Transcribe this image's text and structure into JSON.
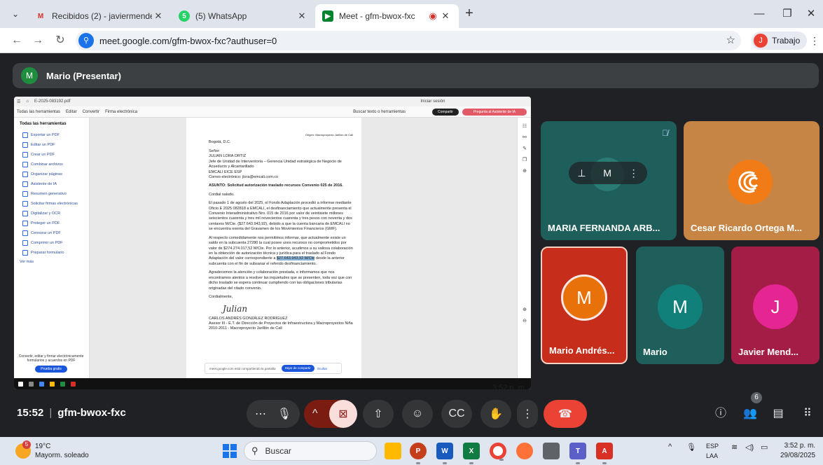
{
  "browser": {
    "tabs": [
      {
        "title": "Recibidos (2) - javiermendez@!",
        "favicon": "M",
        "color": "#d93025",
        "active": false
      },
      {
        "title": "(5) WhatsApp",
        "favicon": "5",
        "color": "#25d366",
        "active": false
      },
      {
        "title": "Meet - gfm-bwox-fxc",
        "favicon": "▶",
        "color": "#00832d",
        "active": true
      }
    ],
    "url": "meet.google.com/gfm-bwox-fxc?authuser=0",
    "profile": {
      "initial": "J",
      "name": "Trabajo"
    }
  },
  "meet": {
    "presenter": {
      "initial": "M",
      "label": "Mario (Presentar)"
    },
    "meeting_time": "15:52",
    "meeting_code": "gfm-bwox-fxc",
    "people_count": "6",
    "participants": [
      {
        "name": "MARIA FERNANDA ARB...",
        "initial": "M"
      },
      {
        "name": "Cesar Ricardo Ortega M...",
        "initial": "C"
      },
      {
        "name": "Mario Andrés...",
        "initial": "M"
      },
      {
        "name": "Mario",
        "initial": "M"
      },
      {
        "name": "Javier Mend...",
        "initial": "J"
      }
    ]
  },
  "shared_screen": {
    "tab_title": "E-2025-083192.pdf",
    "acrobat_tabs": [
      "Todas las herramientas",
      "Editar",
      "Convertir",
      "Firma electrónica"
    ],
    "search_text": "Buscar texto o herramientas",
    "share_btn": "Compartir",
    "ai_btn": "Pregunta al Asistente de IA",
    "signin": "Iniciar sesión",
    "panel_title": "Todas las herramientas",
    "panel_items": [
      "Exportar un PDF",
      "Editar un PDF",
      "Crear un PDF",
      "Combinar archivos",
      "Organizar páginas",
      "Asistente de IA",
      "Resumen generativo",
      "Solicitar firmas electrónicas",
      "Digitalizar y OCR",
      "Proteger un PDF",
      "Censurar un PDF",
      "Comprimir un PDF",
      "Preparar formulario"
    ],
    "panel_more": "Ver más",
    "panel_promo": "Convertir, editar y firmar electrónicamente formularios y acuerdos en PDF",
    "panel_try": "Prueba gratis",
    "doc": {
      "header_small": "Origen: Macroproyecto Jarillón de Cali",
      "place_date": "Bogotá, D.C.",
      "greeting_to": "Señor:",
      "recipient": "JULIAN LORA ORTIZ",
      "recipient_role": "Jefe de Unidad de Interventoría – Gerencia Unidad estratégica de Negocio de Acueducto y Alcantarillado",
      "recipient_org": "EMCALI EICE ESP",
      "recipient_email": "Correo electrónico: jlora@emcali.com.co",
      "subject": "ASUNTO: Solicitud autorización traslado recursos Convenio 025 de 2016.",
      "salutation": "Cordial saludo.",
      "p1": "El pasado 1 de agosto del 2025, el Fondo Adaptación procedió a informar mediante Oficio E 2025 082818 a EMCALI, el desfinanciamiento que actualmente presenta el Convenio Interadministrativo Nro. 015 de 2016 por valor de veintisiete millones seiscientos cuarenta y tres mil novecientos cuarenta y tres pesos con noventa y dos centavos M/Cte. ($27.643.943,92), debido a que la cuenta bancaria de EMCALI no se encuentra exenta del Gravamen de los Movimientos Financieros (GMF).",
      "p2a": "Al respecto comedidamente nos permitimos informar, que actualmente existe un saldo en la subcuenta 27280 la cual posee unos recursos no comprometidos por valor de $274.274.017,52 M/Cte. Por lo anterior, acudimos a su valiosa colaboración en la obtención de autorización técnica y jurídica para el traslado al Fondo Adaptación del valor correspondiente a",
      "p2hl": "$27.643.943,92 M/Cte",
      "p2b": "desde la anterior subcuenta con el fin de subsanar el referido desfinanciamiento.",
      "p3": "Agradecemos la atención y colaboración prestada, e informamos que nos encontramos atentos a resolver las inquietudes que se presenten, toda vez que con dicho traslado se espera continuar cumpliendo con las obligaciones tributarias originadas del citado convenio.",
      "closing": "Cordialmente,",
      "signature": "Julian",
      "sender": "CARLOS ANDRÉS GONZÁLEZ RODRÍGUEZ",
      "sender_role": "Asesor III - E.T. de Dirección de Proyectos de Infraestructura y Macroproyectos Niña 2010-2011 - Macroproyecto Jarillón de Cali"
    },
    "share_note": "meet.google.com está compartiendo la pantalla",
    "share_stop": "Dejar de compartir",
    "share_hide": "Ocultar"
  },
  "taskbar": {
    "weather_temp": "19°C",
    "weather_desc": "Mayorm. soleado",
    "weather_badge": "5",
    "search_label": "Buscar",
    "lang_top": "ESP",
    "lang_bottom": "LAA",
    "time": "3:52 p. m.",
    "date": "29/08/2025"
  }
}
